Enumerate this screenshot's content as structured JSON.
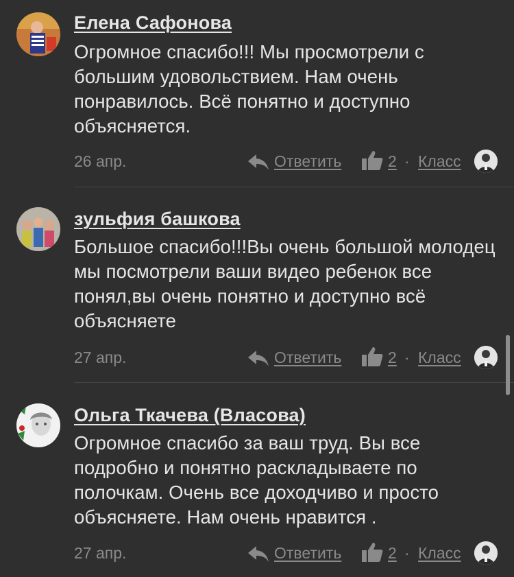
{
  "comments": [
    {
      "author": "Елена Сафонова",
      "text": "Огромное спасибо!!! Мы просмотрели с большим удовольствием. Нам очень понравилось. Всё понятно и доступно объясняется.",
      "date": "26 апр.",
      "reply_label": "Ответить",
      "likes": "2",
      "separator": "·",
      "klass_label": "Класс",
      "avatar_icon": "user-photo-avatar",
      "liker_icon": "liker-avatar"
    },
    {
      "author": "зульфия башкова",
      "text": "Большое спасибо!!!Вы очень большой молодец мы посмотрели ваши видео ребенок все понял,вы очень понятно и доступно всё объясняете",
      "date": "27 апр.",
      "reply_label": "Ответить",
      "likes": "2",
      "separator": "·",
      "klass_label": "Класс",
      "avatar_icon": "user-photo-avatar",
      "liker_icon": "liker-avatar"
    },
    {
      "author": "Ольга Ткачева (Власова)",
      "text": "Огромное спасибо за ваш труд. Вы все подробно и понятно раскладываете по полочкам. Очень все доходчиво и просто объясняете. Нам очень нравится .",
      "date": "27 апр.",
      "reply_label": "Ответить",
      "likes": "2",
      "separator": "·",
      "klass_label": "Класс",
      "avatar_icon": "user-photo-avatar",
      "liker_icon": "liker-avatar"
    }
  ],
  "colors": {
    "background": "#2f2f2f",
    "text": "#e6e6e6",
    "meta": "#8a8a8a"
  }
}
